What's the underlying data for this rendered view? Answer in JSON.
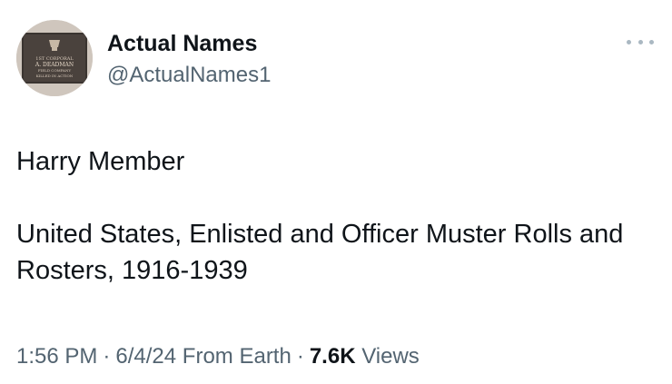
{
  "author": {
    "name": "Actual Names",
    "handle": "@ActualNames1",
    "avatar_text": [
      "1ST CORPORAL",
      "A. DEADMAN",
      "FIELD COMPANY",
      "KILLED IN ACTION"
    ]
  },
  "tweet": {
    "line1": "Harry Member",
    "line2": "United States, Enlisted and Officer Muster Rolls and Rosters, 1916-1939"
  },
  "meta": {
    "time": "1:56 PM",
    "date": "6/4/24",
    "source": "From Earth",
    "views_count": "7.6K",
    "views_label": "Views",
    "separator": "·"
  },
  "colors": {
    "text_primary": "#0f1419",
    "text_secondary": "#536471",
    "more_dots": "#aab8c2"
  },
  "icons": {
    "more": "more-horizontal-icon"
  }
}
